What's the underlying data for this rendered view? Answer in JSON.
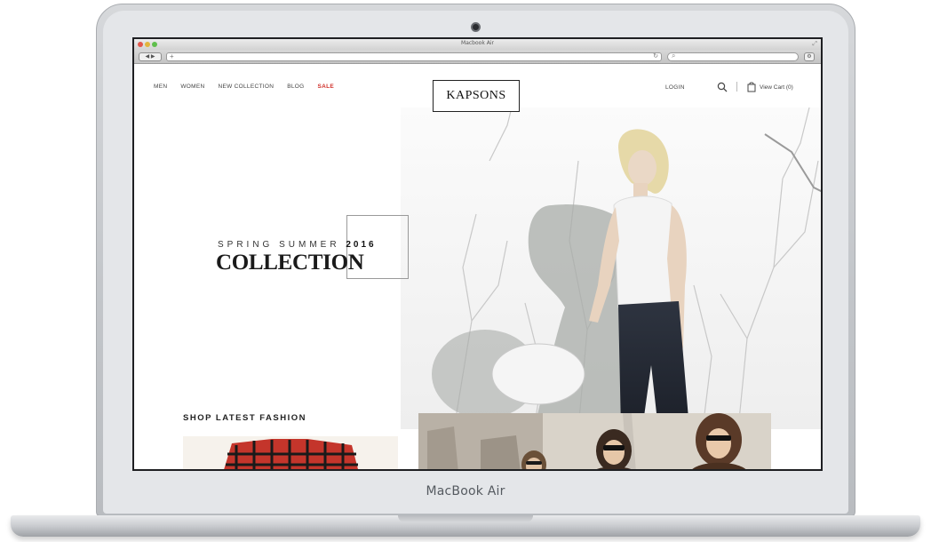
{
  "device": {
    "brand_label": "MacBook Air"
  },
  "browser": {
    "window_title": "Macbook Air"
  },
  "nav": {
    "items": [
      "MEN",
      "WOMEN",
      "NEW COLLECTION",
      "BLOG"
    ],
    "sale": "SALE"
  },
  "logo": {
    "text": "KAPSONS"
  },
  "header": {
    "login": "LOGIN",
    "cart": "View Cart (0)"
  },
  "hero": {
    "line1": "SPRING SUMMER",
    "year": "2016",
    "line2": "COLLECTION"
  },
  "sections": {
    "shop_latest": "SHOP LATEST FASHION"
  },
  "colors": {
    "sale": "#d0302a",
    "text": "#222222"
  }
}
